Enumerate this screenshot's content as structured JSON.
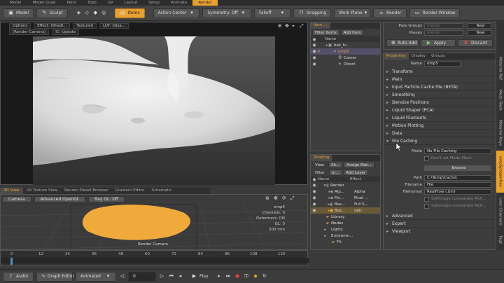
{
  "layout_tabs": [
    "Model",
    "Model Quad",
    "Paint",
    "Topo",
    "UV",
    "Layout",
    "Setup",
    "Animate",
    "Render"
  ],
  "layout_active": "Render",
  "toolbar": {
    "model": "Model",
    "sculpt": "Sculpt",
    "items": "Items",
    "action_center": "Action Center",
    "symmetry": "Symmetry: Off",
    "falloff": "Falloff",
    "snapping": "Snapping",
    "work_plane": "Work Plane",
    "render": "Render",
    "render_window": "Render Window"
  },
  "viewport": {
    "options": "Options",
    "effect": "Effect: (Shadi...",
    "textured": "Textured",
    "lut": "LUT: (disa...",
    "camera": "(Render Camera)",
    "update": "IC: Update"
  },
  "bottom_tabs": [
    "3D View",
    "UV Texture View",
    "Render Preset Browser",
    "Gradient Editor",
    "Schematic"
  ],
  "bottom_view": {
    "camera": "Camera",
    "advanced": "Advanced OpenGL",
    "raygl": "Ray GL: Off",
    "info": [
      "emp5",
      "Channels: 0",
      "Deformers: ON",
      "GL: 0",
      "500 mm"
    ],
    "render_camera": "Render Camera"
  },
  "timeline_ticks": [
    "0",
    "12",
    "24",
    "36",
    "48",
    "60",
    "72",
    "84",
    "96",
    "108",
    "120"
  ],
  "transport": {
    "audio": "Audio",
    "graph_editor": "Graph Editor",
    "animated": "Animated",
    "frame": "0",
    "play": "Play"
  },
  "item_panel": {
    "tabs": [
      "Item ..."
    ],
    "filter": "Filter Items",
    "add": "Add Item",
    "col_name": "Name",
    "rows": [
      "bak_tu",
      "emp5",
      "Camer",
      "Direct"
    ]
  },
  "shading_panel": {
    "tab": "Shading",
    "view": "View",
    "view_val": "Sh...",
    "assign": "Assign Mat...",
    "filter": "Filter",
    "filter_val": "(n...",
    "add_layer": "Add Layer",
    "col_name": "Name",
    "col_effect": "Effect",
    "rows": [
      {
        "name": "Render",
        "effect": ""
      },
      {
        "name": "Alp...",
        "effect": "Alpha"
      },
      {
        "name": "Fin...",
        "effect": "Final ..."
      },
      {
        "name": "Bas...",
        "effect": "Full S..."
      },
      {
        "name": "Bas...",
        "effect": "(all)"
      },
      {
        "name": "Library",
        "effect": ""
      },
      {
        "name": "Nodes",
        "effect": ""
      },
      {
        "name": "Lights",
        "effect": ""
      },
      {
        "name": "Environm...",
        "effect": ""
      },
      {
        "name": "FX",
        "effect": ""
      }
    ]
  },
  "right_top": {
    "pass_groups": "Pass Groups",
    "pass_val": "(none)",
    "new1": "New",
    "passes": "Passes",
    "passes_val": "(none)",
    "new2": "New",
    "auto_add": "Auto Add",
    "apply": "Apply",
    "discard": "Discard"
  },
  "props": {
    "tabs": [
      "Properties",
      "Display",
      "Groups"
    ],
    "name_label": "Name",
    "name_value": "emp5",
    "sections": [
      "Transform",
      "Main",
      "Input Particle Cache File (BETA)",
      "Smoothing",
      "Denoise Positions",
      "Liquid Shaper (PCA)",
      "Liquid Filaments",
      "Motion Plotting",
      "Data",
      "File Caching"
    ],
    "mode_label": "Mode",
    "mode_value": "No File Caching",
    "dont_set": "Don't set Mode Mesh",
    "browse": "Browse",
    "path_label": "Path",
    "path_value": "C:\\Temp\\Cache\\",
    "filename_label": "Filename",
    "filename_value": "File",
    "fileformat_label": "Fileformat",
    "fileformat_value": "RealFlow  (.bin)",
    "softimage1": "Softimage compatible Mcfi...",
    "softimage2": "Softimage compatible Mcfi...",
    "bottom_sections": [
      "Advanced",
      "Expert",
      "Viewport"
    ]
  },
  "side_tabs": [
    "Material Ref",
    "Mesh Tools",
    "Material Rays",
    "emp5properties",
    "User Channels",
    "Tags"
  ]
}
